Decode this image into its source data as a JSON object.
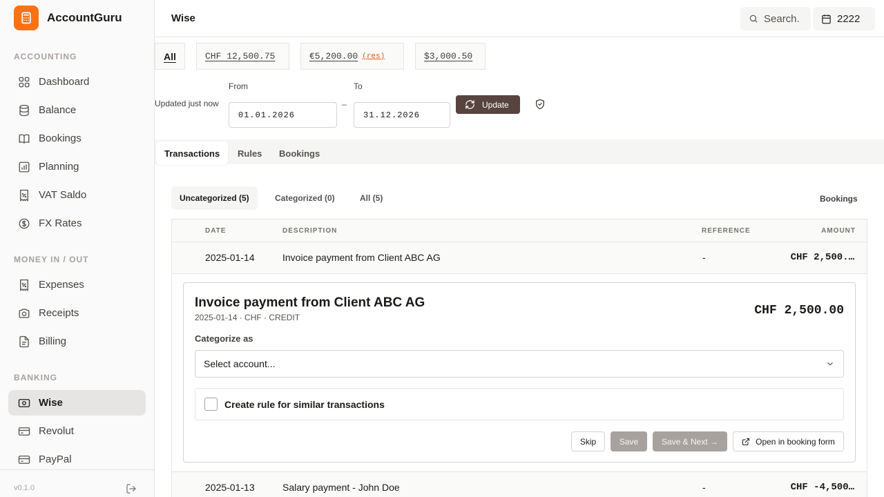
{
  "app": {
    "name": "AccountGuru",
    "version": "v0.1.0"
  },
  "sidebar": {
    "sections": [
      {
        "label": "ACCOUNTING"
      },
      {
        "label": "MONEY IN / OUT"
      },
      {
        "label": "BANKING"
      }
    ],
    "items": [
      {
        "label": "Dashboard",
        "icon": "grid-icon"
      },
      {
        "label": "Balance",
        "icon": "database-icon"
      },
      {
        "label": "Bookings",
        "icon": "book-icon"
      },
      {
        "label": "Planning",
        "icon": "bar-chart-icon"
      },
      {
        "label": "VAT Saldo",
        "icon": "percent-receipt-icon"
      },
      {
        "label": "FX Rates",
        "icon": "dollar-circle-icon"
      },
      {
        "label": "Expenses",
        "icon": "percent-receipt-icon"
      },
      {
        "label": "Receipts",
        "icon": "camera-icon"
      },
      {
        "label": "Billing",
        "icon": "file-text-icon"
      },
      {
        "label": "Wise",
        "icon": "banknote-icon",
        "active": true
      },
      {
        "label": "Revolut",
        "icon": "credit-card-icon"
      },
      {
        "label": "PayPal",
        "icon": "credit-card-icon"
      }
    ]
  },
  "header": {
    "title": "Wise",
    "search_label": "Search.",
    "year": "2222"
  },
  "balances": {
    "all_label": "All",
    "chf": "CHF 12,500.75",
    "eur": "€5,200.00",
    "eur_tag": "(res)",
    "usd": "$3,000.50"
  },
  "sync": {
    "status": "Updated just now",
    "from_label": "From",
    "to_label": "To",
    "from_value": "01.01.2026",
    "to_value": "31.12.2026",
    "separator": "–",
    "update_label": "Update"
  },
  "tabs": [
    "Transactions",
    "Rules",
    "Bookings"
  ],
  "subtabs": [
    "Uncategorized (5)",
    "Categorized (0)",
    "All (5)"
  ],
  "bookings_link": "Bookings",
  "table": {
    "columns": [
      "DATE",
      "DESCRIPTION",
      "REFERENCE",
      "AMOUNT"
    ],
    "rows": [
      {
        "date": "2025-01-14",
        "description": "Invoice payment from Client ABC AG",
        "reference": "-",
        "amount": "CHF 2,500.…"
      },
      {
        "date": "2025-01-13",
        "description": "Salary payment - John Doe",
        "reference": "-",
        "amount": "CHF -4,500…"
      }
    ]
  },
  "detail": {
    "title": "Invoice payment from Client ABC AG",
    "meta": "2025-01-14 · CHF · CREDIT",
    "amount": "CHF 2,500.00",
    "categorize_label": "Categorize as",
    "select_placeholder": "Select account...",
    "rule_label": "Create rule for similar transactions",
    "skip_label": "Skip",
    "save_label": "Save",
    "save_next_label": "Save & Next →",
    "open_form_label": "Open in booking form"
  },
  "colors": {
    "brand": "#f97316",
    "update_button": "#57443f",
    "reserved_tag": "#ea580c"
  }
}
